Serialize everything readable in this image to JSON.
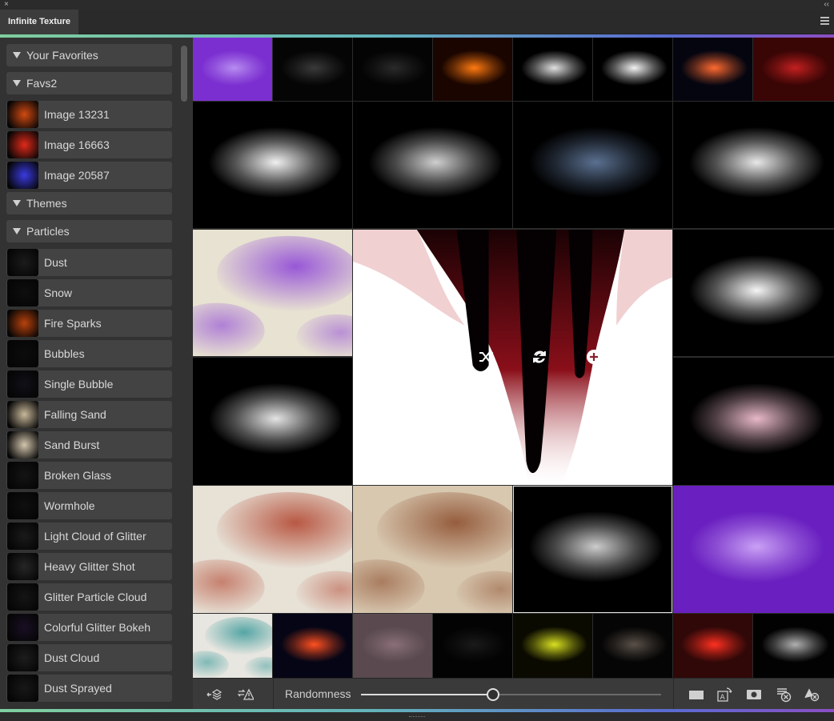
{
  "window": {
    "tab_title": "Infinite Texture",
    "close_glyph": "×",
    "collapse_glyph": "‹‹"
  },
  "sidebar": {
    "headers_top": [
      {
        "label": "Your Favorites"
      },
      {
        "label": "Favs2"
      }
    ],
    "favorites": [
      {
        "label": "Image 13231",
        "thumb_color": "#d24a12"
      },
      {
        "label": "Image 16663",
        "thumb_color": "#e02a1a"
      },
      {
        "label": "Image 20587",
        "thumb_color": "#3a3ae0"
      }
    ],
    "themes_header": {
      "label": "Themes"
    },
    "particles_header": {
      "label": "Particles"
    },
    "particles": [
      {
        "label": "Dust",
        "thumb_color": "#1b1b1b"
      },
      {
        "label": "Snow",
        "thumb_color": "#0e0e0e"
      },
      {
        "label": "Fire Sparks",
        "thumb_color": "#b8420d"
      },
      {
        "label": "Bubbles",
        "thumb_color": "#0c0c0c"
      },
      {
        "label": "Single Bubble",
        "thumb_color": "#101018"
      },
      {
        "label": "Falling Sand",
        "thumb_color": "#c9b99a"
      },
      {
        "label": "Sand Burst",
        "thumb_color": "#d4c6ad"
      },
      {
        "label": "Broken Glass",
        "thumb_color": "#141414"
      },
      {
        "label": "Wormhole",
        "thumb_color": "#0f0f0f"
      },
      {
        "label": "Light Cloud of Glitter",
        "thumb_color": "#1a1a1a"
      },
      {
        "label": "Heavy Glitter Shot",
        "thumb_color": "#262626"
      },
      {
        "label": "Glitter Particle Cloud",
        "thumb_color": "#151515"
      },
      {
        "label": "Colorful Glitter Bokeh",
        "thumb_color": "#1a0f24"
      },
      {
        "label": "Dust Cloud",
        "thumb_color": "#1d1d1d"
      },
      {
        "label": "Dust Sprayed",
        "thumb_color": "#181818"
      }
    ]
  },
  "grid": {
    "tiles": [
      {
        "name": "tile-purple-glitter-small",
        "colors": [
          "#7b2fd0",
          "#b78cf0"
        ]
      },
      {
        "name": "tile-dark-splash-small",
        "colors": [
          "#050505",
          "#3a3a3a"
        ]
      },
      {
        "name": "tile-dark-smoke-small",
        "colors": [
          "#040404",
          "#2a2a2a"
        ]
      },
      {
        "name": "tile-fire-small",
        "colors": [
          "#1a0500",
          "#ff7a10"
        ]
      },
      {
        "name": "tile-white-splash-small",
        "colors": [
          "#000000",
          "#e0e0e0"
        ]
      },
      {
        "name": "tile-white-cloud-small",
        "colors": [
          "#000000",
          "#f2f2f2"
        ]
      },
      {
        "name": "tile-lens-flare-small",
        "colors": [
          "#050510",
          "#ff6a30"
        ]
      },
      {
        "name": "tile-red-vortex-small",
        "colors": [
          "#3a0505",
          "#c42020"
        ]
      },
      {
        "name": "tile-white-splash-large",
        "colors": [
          "#000000",
          "#f0f0f0"
        ]
      },
      {
        "name": "tile-feathers",
        "colors": [
          "#000000",
          "#cfcfcf"
        ]
      },
      {
        "name": "tile-dark-liquid",
        "colors": [
          "#000000",
          "#5a7090"
        ]
      },
      {
        "name": "tile-milk-wave",
        "colors": [
          "#000000",
          "#e8e8e8"
        ]
      },
      {
        "name": "tile-purple-watercolor",
        "colors": [
          "#e8e2d2",
          "#8a3fd8"
        ]
      },
      {
        "name": "tile-red-drips-featured",
        "colors": [
          "#ffffff",
          "#8a0f1a"
        ]
      },
      {
        "name": "tile-white-milk-pour",
        "colors": [
          "#000000",
          "#f5f5f5"
        ]
      },
      {
        "name": "tile-torn-paper",
        "colors": [
          "#000000",
          "#e4e4e4"
        ]
      },
      {
        "name": "tile-glitter-bokeh",
        "colors": [
          "#000000",
          "#e8b8c8"
        ]
      },
      {
        "name": "tile-red-floral-texture",
        "colors": [
          "#e7e1d6",
          "#b0402a"
        ]
      },
      {
        "name": "tile-rust-texture",
        "colors": [
          "#d8c8b0",
          "#8a4a2a"
        ]
      },
      {
        "name": "tile-liquid-splash-selected",
        "colors": [
          "#000000",
          "#cccccc"
        ]
      },
      {
        "name": "tile-purple-glitter-large",
        "colors": [
          "#6a20c0",
          "#c9a0f5"
        ]
      },
      {
        "name": "tile-teal-watercolor",
        "colors": [
          "#e8e6e0",
          "#3a9a9a"
        ]
      },
      {
        "name": "tile-blue-flare",
        "colors": [
          "#050515",
          "#ff5020"
        ]
      },
      {
        "name": "tile-mauve-grain",
        "colors": [
          "#5a4a50",
          "#8a7078"
        ]
      },
      {
        "name": "tile-dark-dust",
        "colors": [
          "#030303",
          "#1a1a1a"
        ]
      },
      {
        "name": "tile-yellow-swirl",
        "colors": [
          "#0a0a00",
          "#d8e020"
        ]
      },
      {
        "name": "tile-dark-glow",
        "colors": [
          "#050505",
          "#5a5048"
        ]
      },
      {
        "name": "tile-red-laser",
        "colors": [
          "#300808",
          "#ff3020"
        ]
      },
      {
        "name": "tile-dark-spray",
        "colors": [
          "#020202",
          "#b0b0b0"
        ]
      }
    ],
    "overlay_icons": [
      "heart-icon",
      "shuffle-icon",
      "refresh-icon",
      "add-circle-icon"
    ]
  },
  "toolbar": {
    "randomness_label": "Randomness",
    "randomness_value": 0.44,
    "left_icons": [
      "layers-arrow-icon",
      "swap-warning-icon"
    ],
    "right_icons": [
      "rectangle-icon",
      "text-replace-icon",
      "camera-icon",
      "remove-stack-icon",
      "clear-layers-icon"
    ]
  },
  "colors": {
    "accent_start": "#7fcf9f",
    "accent_mid": "#63b3bb",
    "accent_end": "#8b4fc4",
    "panel_bg": "#323232",
    "item_bg": "#434343"
  }
}
